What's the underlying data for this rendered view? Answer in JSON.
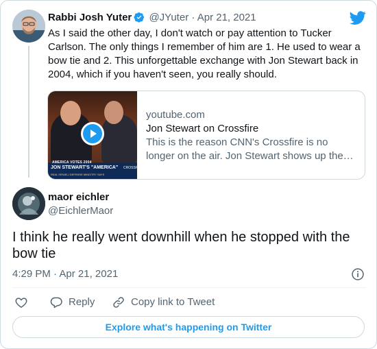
{
  "colors": {
    "accent": "#1d9bf0",
    "muted": "#536471",
    "text": "#0f1419",
    "border": "#cfd9de"
  },
  "original_tweet": {
    "author_name": "Rabbi Josh Yuter",
    "handle": "@JYuter",
    "separator": "·",
    "date": "Apr 21, 2021",
    "verified_icon": "verified-badge-icon",
    "text": "As I said the other day, I don't watch or pay attention to Tucker Carlson. The only things I remember of him are 1. He used to wear a bow tie and 2. This unforgettable exchange with Jon Stewart back in 2004, which if you haven't seen, you really should.",
    "link_card": {
      "domain": "youtube.com",
      "title": "Jon Stewart on Crossfire",
      "description": "This is the reason CNN's Crossfire is no longer on the air. Jon Stewart shows up the…",
      "thumbnail_caption_small": "AMERICA VOTES 2004",
      "thumbnail_caption": "JON STEWART'S \"AMERICA\"",
      "thumbnail_ticker": "REAL ISRAELI DEFENSE MINISTRY SAYS",
      "thumbnail_tag": "CROSSF",
      "play_icon": "play-icon"
    }
  },
  "reply_tweet": {
    "author_name": "maor eichler",
    "handle": "@EichlerMaor",
    "text": "I think he really went downhill when he stopped with the bow tie",
    "time": "4:29 PM",
    "separator": "·",
    "date": "Apr 21, 2021"
  },
  "actions": {
    "like_icon": "heart-icon",
    "reply_label": "Reply",
    "copy_link_label": "Copy link to Tweet"
  },
  "explore_button": "Explore what's happening on Twitter",
  "logo": "twitter-bird-icon"
}
